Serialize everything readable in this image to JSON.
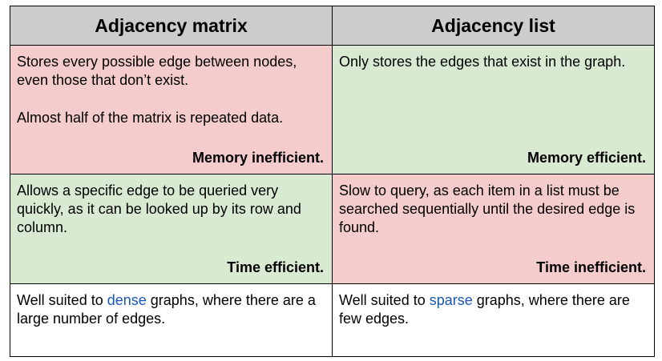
{
  "colors": {
    "header_bg": "#cccccc",
    "inefficient_bg": "#f4cccc",
    "efficient_bg": "#d9ead3",
    "neutral_bg": "#ffffff",
    "highlight_text": "#1a56b7",
    "border": "#000000"
  },
  "table": {
    "headers": [
      "Adjacency matrix",
      "Adjacency list"
    ],
    "memory": {
      "matrix": {
        "lines": [
          "Stores every possible edge between nodes, even those that don’t exist.",
          "Almost half of the matrix is repeated data."
        ],
        "verdict": "Memory inefficient.",
        "status": "inefficient"
      },
      "list": {
        "lines": [
          "Only stores the edges that exist in the graph."
        ],
        "verdict": "Memory efficient.",
        "status": "efficient"
      }
    },
    "time": {
      "matrix": {
        "lines": [
          "Allows a specific edge to be queried very quickly, as it can be looked up by its row and column."
        ],
        "verdict": "Time efficient.",
        "status": "efficient"
      },
      "list": {
        "lines": [
          "Slow to query, as each item in a list must be searched sequentially until the desired edge is found."
        ],
        "verdict": "Time inefficient.",
        "status": "inefficient"
      }
    },
    "suitability": {
      "matrix": {
        "prefix": "Well suited to ",
        "highlight": "dense",
        "suffix": " graphs, where there are a large number of edges."
      },
      "list": {
        "prefix": "Well suited to ",
        "highlight": "sparse",
        "suffix": " graphs, where there are few edges."
      }
    }
  }
}
